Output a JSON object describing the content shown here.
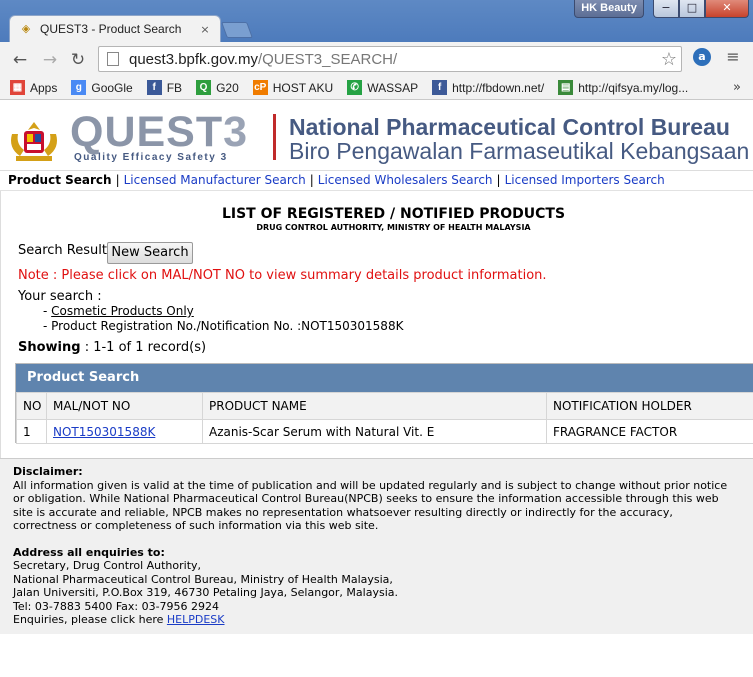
{
  "browser": {
    "tab_title": "QUEST3 - Product Search",
    "tab_close": "×",
    "profile_name": "HK Beauty",
    "url_host": "quest3.bpfk.gov.my",
    "url_path": "/QUEST3_SEARCH/",
    "nav": {
      "back": "←",
      "forward": "→",
      "reload": "↻"
    },
    "window_buttons": {
      "minimize": "−",
      "maximize": "□",
      "close": "✕"
    },
    "bookmarks": [
      {
        "label": "Apps",
        "icon": "apps-grid-icon",
        "color": "#e0453a"
      },
      {
        "label": "GooGle",
        "icon": "google-icon",
        "color": "#4a8af4"
      },
      {
        "label": "FB",
        "icon": "facebook-icon",
        "color": "#3b5998"
      },
      {
        "label": "G20",
        "icon": "g20-icon",
        "color": "#2e9e3e"
      },
      {
        "label": "HOST AKU",
        "icon": "cp-icon",
        "color": "#f07c00"
      },
      {
        "label": "WASSAP",
        "icon": "whatsapp-icon",
        "color": "#25a244"
      },
      {
        "label": "http://fbdown.net/",
        "icon": "fbdown-icon",
        "color": "#3d5a98"
      },
      {
        "label": "http://qifsya.my/log...",
        "icon": "page-icon",
        "color": "#3a8a3a"
      }
    ],
    "bookmarks_more": "»"
  },
  "banner": {
    "logo_main": "QUEST",
    "logo_three": "3",
    "logo_tagline": "Quality Efficacy Safety 3",
    "org_english": "National Pharmaceutical Control Bureau",
    "org_malay": "Biro Pengawalan Farmaseutikal Kebangsaan"
  },
  "subnav": {
    "current": "Product Search",
    "links": [
      "Licensed Manufacturer Search",
      "Licensed Wholesalers Search",
      "Licensed Importers Search"
    ],
    "separator": "|"
  },
  "content": {
    "title": "LIST OF REGISTERED / NOTIFIED PRODUCTS",
    "subtitle": "DRUG CONTROL AUTHORITY, MINISTRY OF HEALTH MALAYSIA",
    "search_result_label": "Search Result",
    "new_search_button": "New Search",
    "note": "Note : Please click on MAL/NOT NO to view summary details product information.",
    "your_search_label": "Your search :",
    "criteria": {
      "c1_prefix": "- ",
      "c1_text": "Cosmetic Products Only",
      "c2": "- Product Registration No./Notification No. :NOT150301588K"
    },
    "showing_label": "Showing",
    "showing_value": " : 1-1 of 1 record(s)"
  },
  "results": {
    "header": "Product Search",
    "columns": [
      "NO",
      "MAL/NOT NO",
      "PRODUCT NAME",
      "NOTIFICATION HOLDER"
    ],
    "rows": [
      {
        "no": "1",
        "mal_not_no": "NOT150301588K",
        "product_name": "Azanis-Scar Serum with Natural Vit. E",
        "holder": "FRAGRANCE FACTOR"
      }
    ]
  },
  "footer": {
    "disclaimer_title": "Disclaimer:",
    "disclaimer_text": "All information given is valid at the time of publication and will be updated regularly and is subject to change without prior notice or obligation. While National Pharmaceutical Control Bureau(NPCB) seeks to ensure the information accessible through this web site is accurate and reliable, NPCB makes no representation whatsoever resulting directly or indirectly for the accuracy, correctness or completeness of such information via this web site.",
    "address_title": "Address all enquiries to:",
    "address_lines": [
      "Secretary, Drug Control Authority,",
      "National Pharmaceutical Control Bureau, Ministry of Health Malaysia,",
      "Jalan Universiti, P.O.Box 319, 46730 Petaling Jaya, Selangor, Malaysia.",
      "Tel: 03-7883 5400 Fax: 03-7956 2924"
    ],
    "enquiries_text": "Enquiries, please click here ",
    "helpdesk_link": "HELPDESK"
  },
  "colors": {
    "table_header_bg": "#5f84ae",
    "note_red": "#e01010",
    "link_blue": "#1a3cc6",
    "logo_grey": "#8b95a8",
    "org_blue": "#465a82"
  }
}
